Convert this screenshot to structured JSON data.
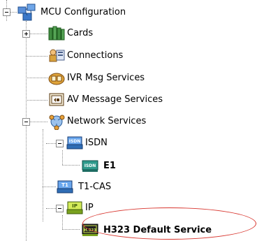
{
  "tree": {
    "root": {
      "label": "MCU Configuration",
      "icon": "mcu-config-icon"
    },
    "cards": {
      "label": "Cards",
      "icon": "cards-icon"
    },
    "connections": {
      "label": "Connections",
      "icon": "connections-icon"
    },
    "ivr": {
      "label": "IVR Msg Services",
      "icon": "ivr-icon"
    },
    "av": {
      "label": "AV Message Services",
      "icon": "av-message-icon"
    },
    "network": {
      "label": "Network Services",
      "icon": "network-services-icon"
    },
    "isdn": {
      "label": "ISDN",
      "icon": "isdn-icon",
      "badge": "ISDN"
    },
    "e1": {
      "label": "E1",
      "icon": "isdn-service-icon",
      "badge": "ISDN"
    },
    "t1cas": {
      "label": "T1-CAS",
      "icon": "t1-icon",
      "badge": "T1"
    },
    "ip": {
      "label": "IP",
      "icon": "ip-icon",
      "badge": "IP"
    },
    "h323": {
      "label": "H323 Default Service",
      "icon": "h323-service-icon",
      "badge": "H.323"
    }
  },
  "colors": {
    "highlight": "#d8362f"
  }
}
